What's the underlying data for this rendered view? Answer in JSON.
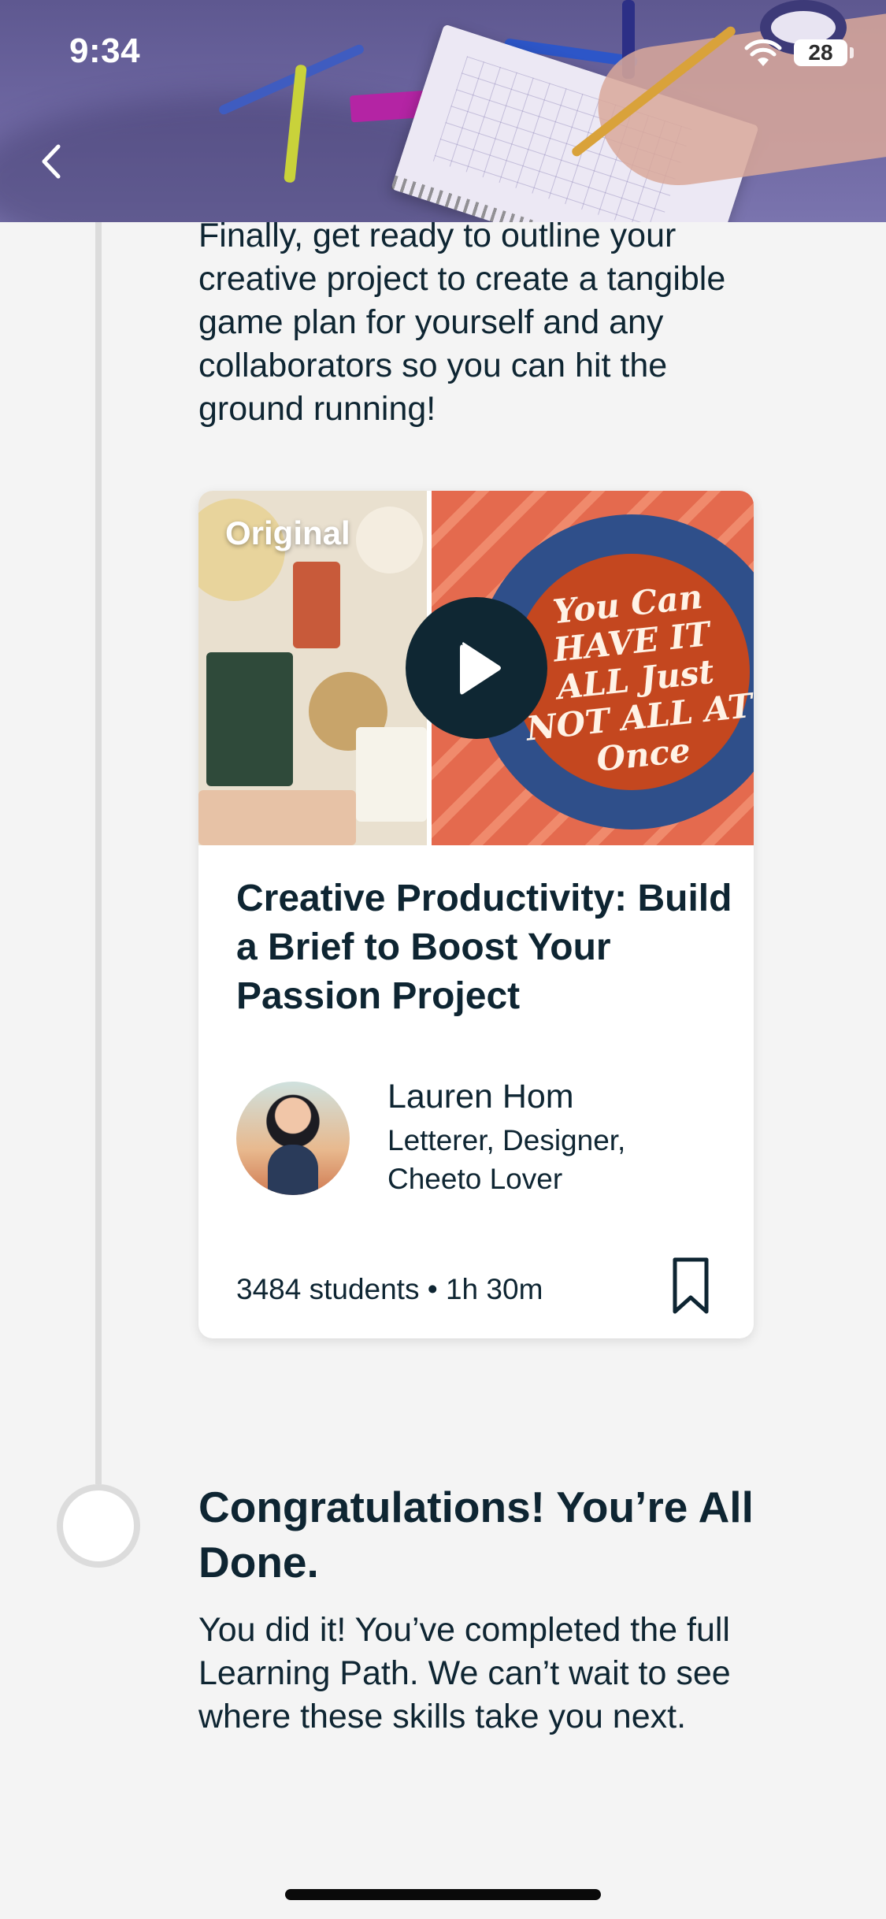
{
  "status_bar": {
    "time": "9:34",
    "battery_level": "28"
  },
  "header": {
    "back_icon": "chevron-left-icon"
  },
  "intro_text": "Finally, get ready to outline your creative project to create a tangible game plan for yourself and any collaborators so you can hit the ground running!",
  "class_card": {
    "badge": "Original",
    "play_icon": "play-icon",
    "title": "Creative Productivity: Build a Brief to Boost Your Passion Project",
    "teacher_name": "Lauren Hom",
    "teacher_description": "Letterer, Designer, Cheeto Lover",
    "meta": "3484 students • 1h 30m",
    "bookmark_icon": "bookmark-icon",
    "thumbnail_lettering": "You Can HAVE IT ALL Just NOT ALL AT Once"
  },
  "congrats": {
    "title": "Congratulations! You’re All Done.",
    "text": "You did it! You’ve completed the full Learning Path. We can’t wait to see where these skills take you next."
  },
  "colors": {
    "background": "#f4f4f4",
    "text": "#0e2532",
    "play_button": "#0f2733",
    "timeline": "#dcdcdc"
  }
}
